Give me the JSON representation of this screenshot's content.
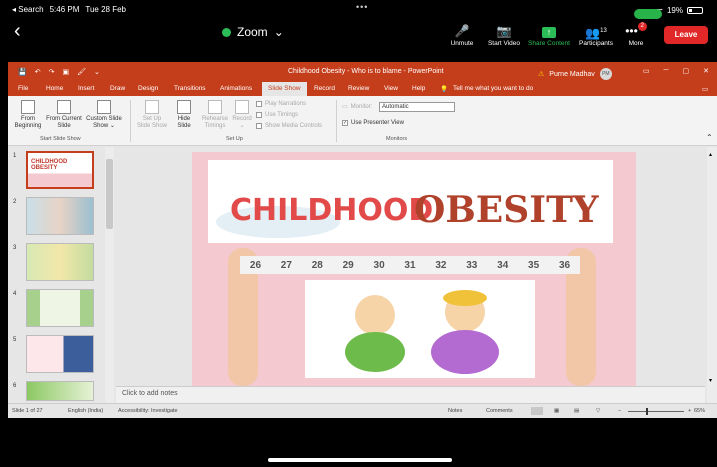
{
  "ios_status": {
    "carrier": "◂ Search",
    "time": "5:46 PM",
    "date": "Tue 28 Feb",
    "wifi": "ᯤ",
    "battery": "19%"
  },
  "zoom": {
    "back": "‹",
    "title": "Zoom",
    "title_caret": "⌄",
    "controls": [
      {
        "label": "Unmute",
        "icon": "🎤"
      },
      {
        "label": "Start Video",
        "icon": "📷"
      },
      {
        "label": "Share Content",
        "icon": "↑"
      },
      {
        "label": "Participants",
        "icon": "👥"
      },
      {
        "label": "More",
        "icon": "•••"
      }
    ],
    "participants_count": "13",
    "more_badge": "2",
    "leave": "Leave",
    "share_color": "#2dbd58",
    "leave_color": "#e02828"
  },
  "ppt": {
    "title": "Childhood Obesity - Who is to blame  -  PowerPoint",
    "user_name": "Purne Madhav",
    "user_initials": "PM",
    "warning_icon": "⚠",
    "quick_access": [
      "💾",
      "↶",
      "↷",
      "▣",
      "🖌",
      "⌄"
    ],
    "window_controls": [
      "▭",
      "─",
      "▢",
      "✕"
    ],
    "tabs": [
      "File",
      "Home",
      "Insert",
      "Draw",
      "Design",
      "Transitions",
      "Animations",
      "Slide Show",
      "Record",
      "Review",
      "View",
      "Help"
    ],
    "tell_me": "Tell me what you want to do",
    "tell_me_icon": "💡",
    "comment_icon": "▭",
    "ribbon": {
      "from_beginning": "From Beginning",
      "from_current": "From Current Slide",
      "custom_show": "Custom Slide Show ⌄",
      "group_start": "Start Slide Show",
      "set_up_show": "Set Up Slide Show",
      "hide_slide": "Hide Slide",
      "rehearse": "Rehearse Timings",
      "record": "Record ⌄",
      "play_narrations": "Play Narrations",
      "use_timings": "Use Timings",
      "show_media": "Show Media Controls",
      "group_setup": "Set Up",
      "monitor_label": "Monitor:",
      "monitor_value": "Automatic",
      "presenter_view": "Use Presenter View",
      "group_monitors": "Monitors"
    },
    "slide_numbers": [
      "1",
      "2",
      "3",
      "4",
      "5",
      "6"
    ],
    "slide_title_a": "CHILDHOOD",
    "slide_title_b": "OBESITY",
    "tape_numbers": [
      "26",
      "27",
      "28",
      "29",
      "30",
      "31",
      "32",
      "33",
      "34",
      "35",
      "36"
    ],
    "notes_placeholder": "Click to add notes",
    "status": {
      "slide_of": "Slide 1 of 27",
      "language": "English (India)",
      "accessibility": "Accessibility: Investigate",
      "notes": "Notes",
      "comments": "Comments",
      "zoom": "65%"
    }
  }
}
